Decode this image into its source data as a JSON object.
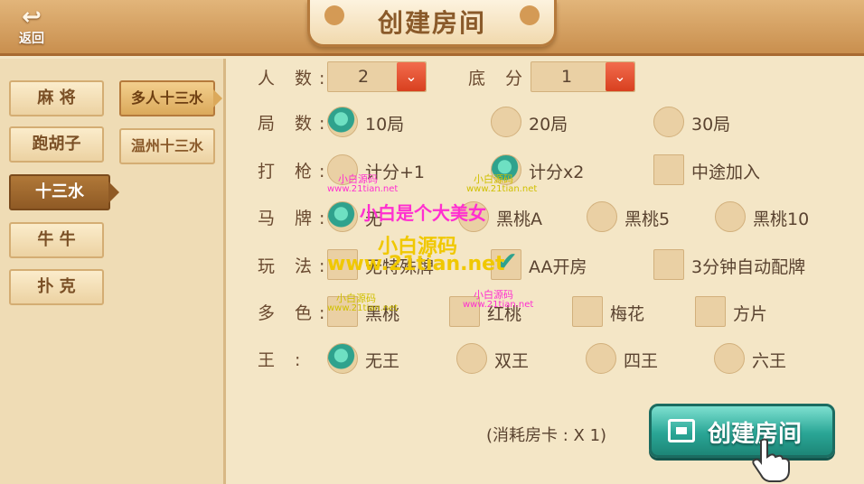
{
  "header": {
    "back_label": "返回",
    "title": "创建房间"
  },
  "games": [
    {
      "label": "麻 将",
      "active": false
    },
    {
      "label": "跑胡子",
      "active": false
    },
    {
      "label": "十三水",
      "active": true
    },
    {
      "label": "牛 牛",
      "active": false
    },
    {
      "label": "扑 克",
      "active": false
    }
  ],
  "variants": [
    {
      "label": "多人十三水",
      "active": true
    },
    {
      "label": "温州十三水",
      "active": false
    }
  ],
  "settings": {
    "players": {
      "label": "人 数:",
      "value": "2"
    },
    "base_score": {
      "label": "底 分:",
      "value": "1"
    },
    "rounds": {
      "label": "局 数:",
      "options": [
        "10局",
        "20局",
        "30局"
      ],
      "selected": "10局"
    },
    "shoot": {
      "label": "打 枪:",
      "options": [
        "计分+1",
        "计分x2",
        "中途加入"
      ],
      "selected": "计分x2"
    },
    "horse": {
      "label": "马 牌:",
      "options": [
        "无",
        "黑桃A",
        "黑桃5",
        "黑桃10"
      ],
      "selected": "无"
    },
    "play": {
      "label": "玩 法:",
      "options": [
        "无特殊牌",
        "AA开房",
        "3分钟自动配牌"
      ],
      "checked": [
        "AA开房"
      ]
    },
    "colors": {
      "label": "多 色:",
      "options": [
        "黑桃",
        "红桃",
        "梅花",
        "方片"
      ],
      "checked": []
    },
    "joker": {
      "label": "王 :",
      "options": [
        "无王",
        "双王",
        "四王",
        "六王"
      ],
      "selected": "无王"
    }
  },
  "footer": {
    "cost_text": "(消耗房卡 : X 1)",
    "create_label": "创建房间"
  },
  "watermarks": {
    "big": "小白是个大美女",
    "name": "小白源码",
    "site": "www.21tian.net",
    "small_name": "小白源码",
    "small_site": "www.21tian.net"
  },
  "colors": {
    "accent_teal": "#2fa28d",
    "dropdown_red": "#e0502f",
    "header_brown": "#c98f4e"
  }
}
